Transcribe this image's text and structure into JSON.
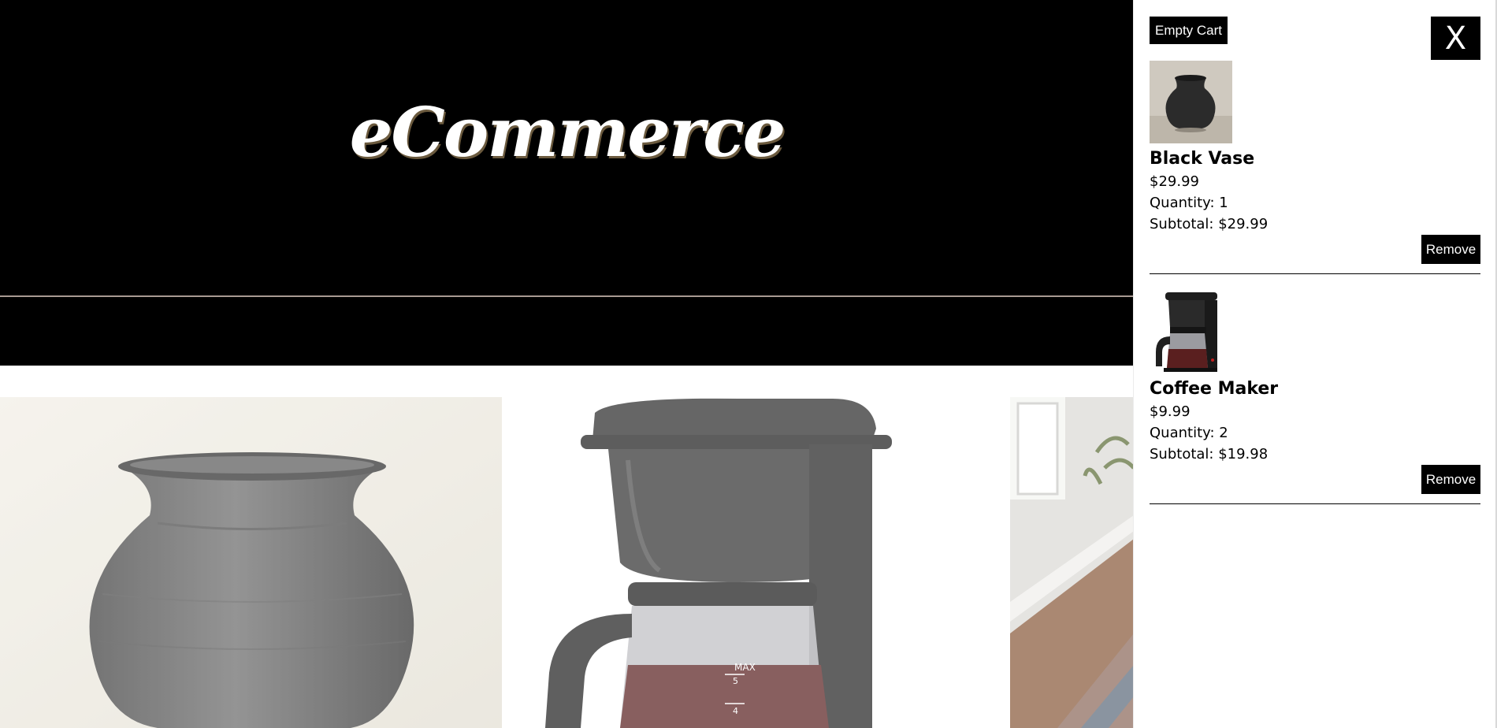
{
  "header": {
    "brand": "eCommerce"
  },
  "products": [
    {
      "name": "black-vase-photo"
    },
    {
      "name": "coffee-maker-photo"
    },
    {
      "name": "room-interior-photo"
    }
  ],
  "cart": {
    "empty_label": "Empty Cart",
    "close_label": "X",
    "remove_label": "Remove",
    "items": [
      {
        "name": "Black Vase",
        "price": "$29.99",
        "quantity": "Quantity: 1",
        "subtotal": "Subtotal: $29.99"
      },
      {
        "name": "Coffee Maker",
        "price": "$9.99",
        "quantity": "Quantity: 2",
        "subtotal": "Subtotal: $19.98"
      }
    ]
  },
  "colors": {
    "hero_bg": "#000000",
    "button_bg": "#000000",
    "button_text": "#ffffff",
    "overlay": "rgba(255,255,255,0.28)"
  }
}
